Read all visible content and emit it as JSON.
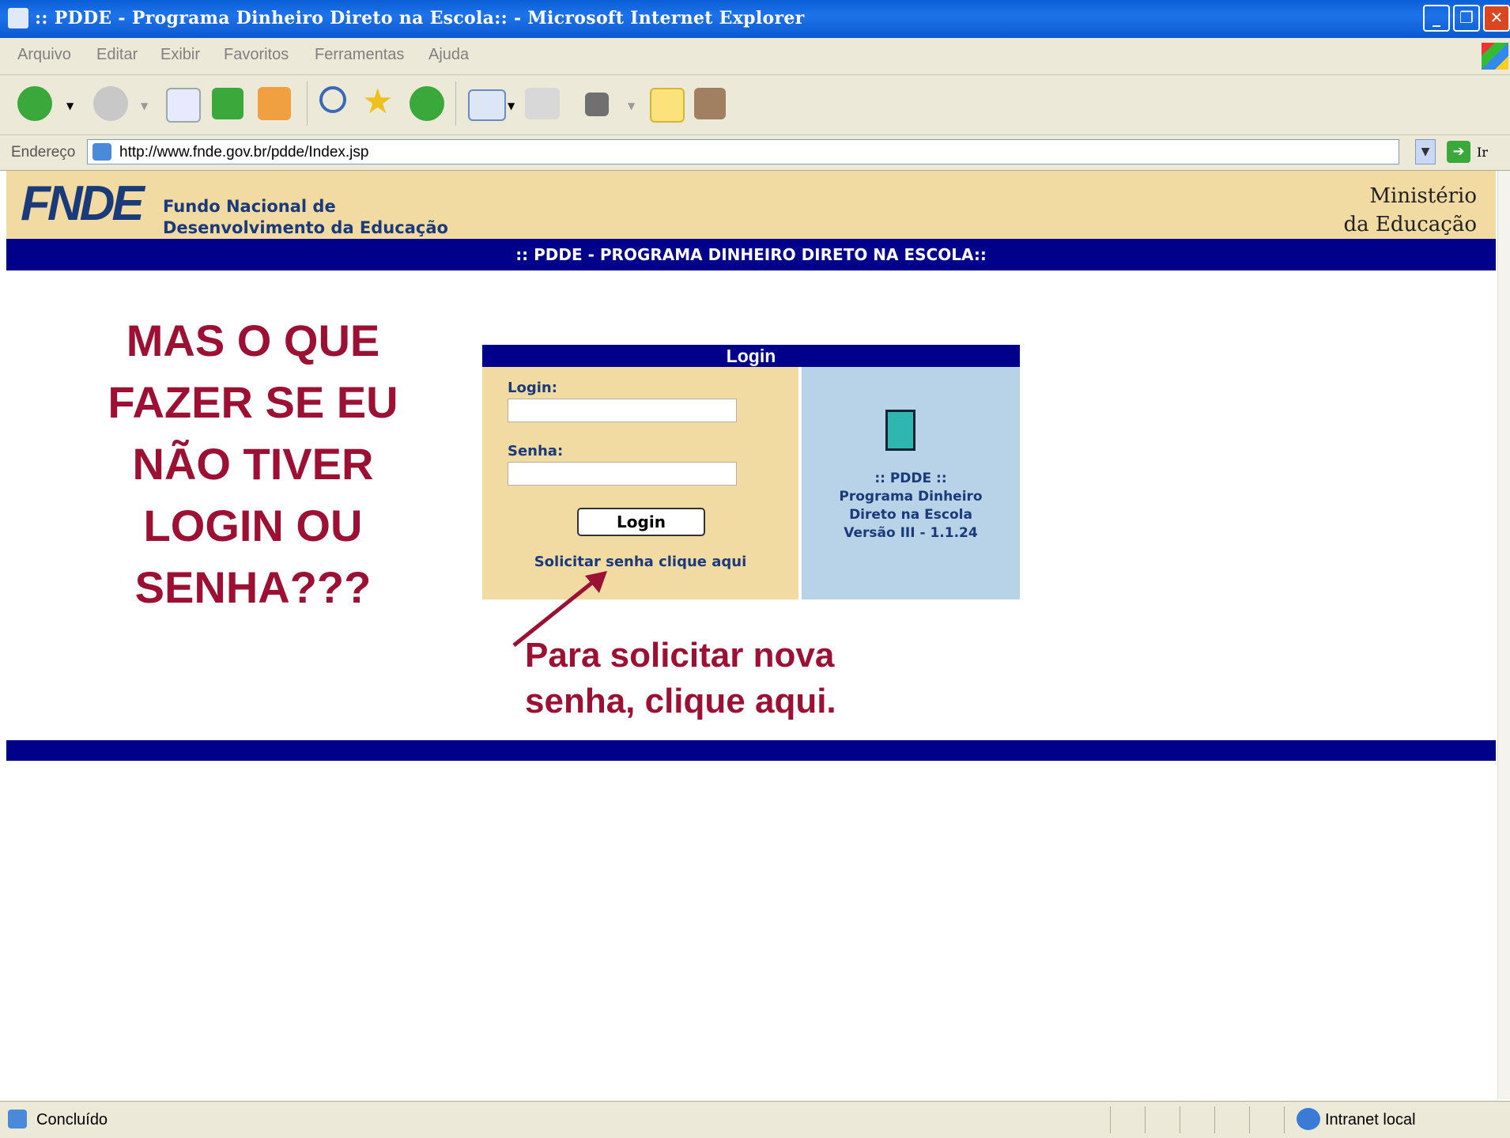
{
  "window": {
    "title": ":: PDDE - Programa Dinheiro Direto na Escola:: - Microsoft Internet Explorer"
  },
  "menu": [
    "Arquivo",
    "Editar",
    "Exibir",
    "Favoritos",
    "Ferramentas",
    "Ajuda"
  ],
  "toolbar_icons": [
    "back-icon",
    "forward-icon",
    "stop-icon",
    "refresh-icon",
    "home-icon",
    "search-icon",
    "favorites-icon",
    "history-icon",
    "mail-icon",
    "print-icon",
    "edit-icon",
    "note-icon",
    "research-icon"
  ],
  "address": {
    "label": "Endereço",
    "url": "http://www.fnde.gov.br/pdde/Index.jsp",
    "go_label": "Ir"
  },
  "header": {
    "logo": "FNDE",
    "org_line1": "Fundo Nacional de",
    "org_line2": "Desenvolvimento da Educação",
    "ministry_line1": "Ministério",
    "ministry_line2": "da Educação",
    "banner": ":: PDDE - PROGRAMA DINHEIRO DIRETO NA ESCOLA::"
  },
  "annotation": {
    "question_lines": [
      "MAS O QUE",
      "FAZER SE EU",
      "NÃO TIVER",
      "LOGIN OU",
      "SENHA???"
    ],
    "hint_line1": "Para solicitar nova",
    "hint_line2": "senha, clique aqui."
  },
  "login": {
    "heading": "Login",
    "login_label": "Login:",
    "password_label": "Senha:",
    "login_value": "",
    "password_value": "",
    "button_label": "Login",
    "request_link": "Solicitar senha clique aqui"
  },
  "system_info": {
    "line1": ":: PDDE ::",
    "line2": "Programa Dinheiro",
    "line3": "Direto na Escola",
    "line4": "Versão III - 1.1.24"
  },
  "status": {
    "text": "Concluído",
    "zone": "Intranet local"
  },
  "colors": {
    "accent_red": "#9b1033",
    "navy": "#00008b",
    "beige": "#f2dba3",
    "light_blue": "#b8d2e8"
  }
}
